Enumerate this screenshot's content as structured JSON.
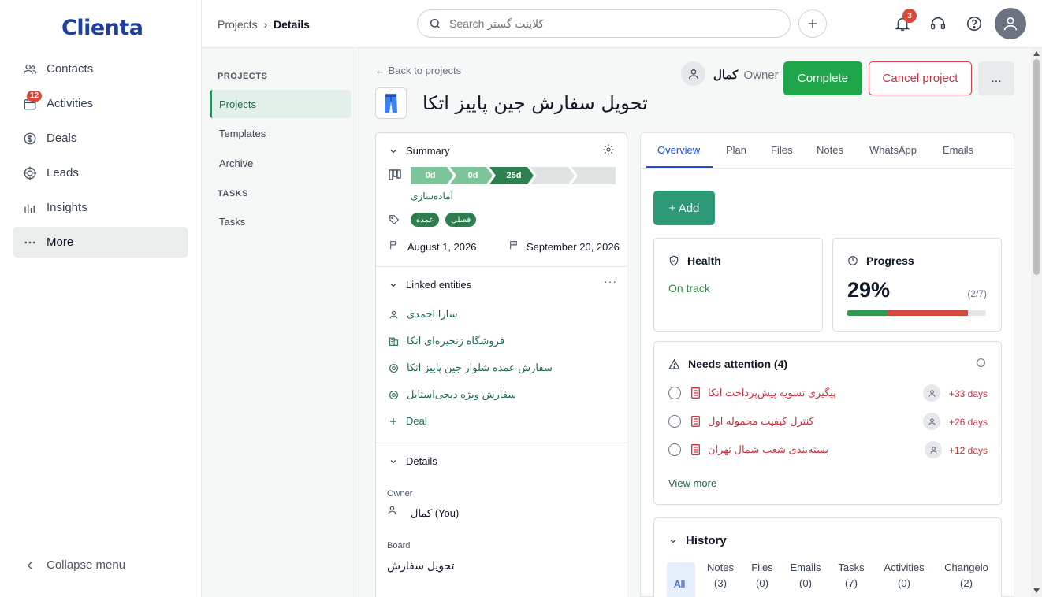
{
  "app": {
    "logo": "Clienta"
  },
  "leftnav": {
    "items": [
      {
        "label": "Contacts",
        "icon": "contacts-icon"
      },
      {
        "label": "Activities",
        "icon": "calendar-icon",
        "badge": "12"
      },
      {
        "label": "Deals",
        "icon": "dollar-icon"
      },
      {
        "label": "Leads",
        "icon": "target-icon"
      },
      {
        "label": "Insights",
        "icon": "bar-chart-icon"
      },
      {
        "label": "More",
        "icon": "more-dots-icon"
      }
    ],
    "collapse_label": "Collapse menu"
  },
  "subnav": {
    "projects_heading": "PROJECTS",
    "projects_items": [
      "Projects",
      "Templates",
      "Archive"
    ],
    "tasks_heading": "TASKS",
    "tasks_items": [
      "Tasks"
    ]
  },
  "topbar": {
    "breadcrumb_parent": "Projects",
    "breadcrumb_sep": "›",
    "breadcrumb_current": "Details",
    "search_placeholder": "Search کلاینت گستر",
    "notifications_badge": "3"
  },
  "header": {
    "back_link": "← Back to projects",
    "title": "تحویل سفارش جین پاییز اتکا",
    "owner_name": "کمال",
    "owner_role": "Owner",
    "complete_label": "Complete",
    "cancel_label": "Cancel project",
    "more_label": "..."
  },
  "summary": {
    "heading": "Summary",
    "stages": [
      "0d",
      "0d",
      "25d",
      "",
      ""
    ],
    "stage_name": "آماده‌سازی",
    "tags": [
      "عمده",
      "فصلی"
    ],
    "start_date": "August 1, 2026",
    "end_date": "September 20, 2026"
  },
  "linked": {
    "heading": "Linked entities",
    "entities": [
      {
        "label": "سارا احمدی",
        "icon": "person-icon"
      },
      {
        "label": "فروشگاه زنجیره‌ای اتکا",
        "icon": "building-icon"
      },
      {
        "label": "سفارش عمده شلوار جین پاییز اتکا",
        "icon": "target-icon"
      },
      {
        "label": "سفارش ویژه دیجی‌استایل",
        "icon": "target-icon"
      }
    ],
    "add_deal_label": "Deal"
  },
  "details": {
    "heading": "Details",
    "owner_label": "Owner",
    "owner_value": "کمال (You)",
    "board_label": "Board",
    "board_value": "تحویل سفارش"
  },
  "tabs": [
    "Overview",
    "Plan",
    "Files",
    "Notes",
    "WhatsApp",
    "Emails"
  ],
  "overview": {
    "add_label": "+ Add",
    "health_heading": "Health",
    "health_value": "On track",
    "progress_heading": "Progress",
    "progress_percent": "29%",
    "progress_count": "(2/7)",
    "progress_fraction": 0.29,
    "progress_overdue_fraction": 0.58,
    "attention_heading": "Needs attention (4)",
    "attention_items": [
      {
        "label": "پیگیری تسویه پیش‌پرداخت اتکا",
        "days": "+33 days"
      },
      {
        "label": "کنترل کیفیت محموله اول",
        "days": "+26 days"
      },
      {
        "label": "بسته‌بندی شعب شمال تهران",
        "days": "+12 days"
      }
    ],
    "view_more": "View more",
    "history_heading": "History",
    "history_tabs": [
      {
        "label": "All",
        "count": ""
      },
      {
        "label": "Notes",
        "count": "(3)"
      },
      {
        "label": "Files",
        "count": "(0)"
      },
      {
        "label": "Emails",
        "count": "(0)"
      },
      {
        "label": "Tasks",
        "count": "(7)"
      },
      {
        "label": "Activities",
        "count": "(0)"
      },
      {
        "label": "Changelo",
        "count": "(2)"
      }
    ]
  },
  "colors": {
    "brand": "#1d3fa0",
    "accent": "#1fa64a",
    "danger": "#c9303f",
    "green_text": "#1d6a48"
  }
}
